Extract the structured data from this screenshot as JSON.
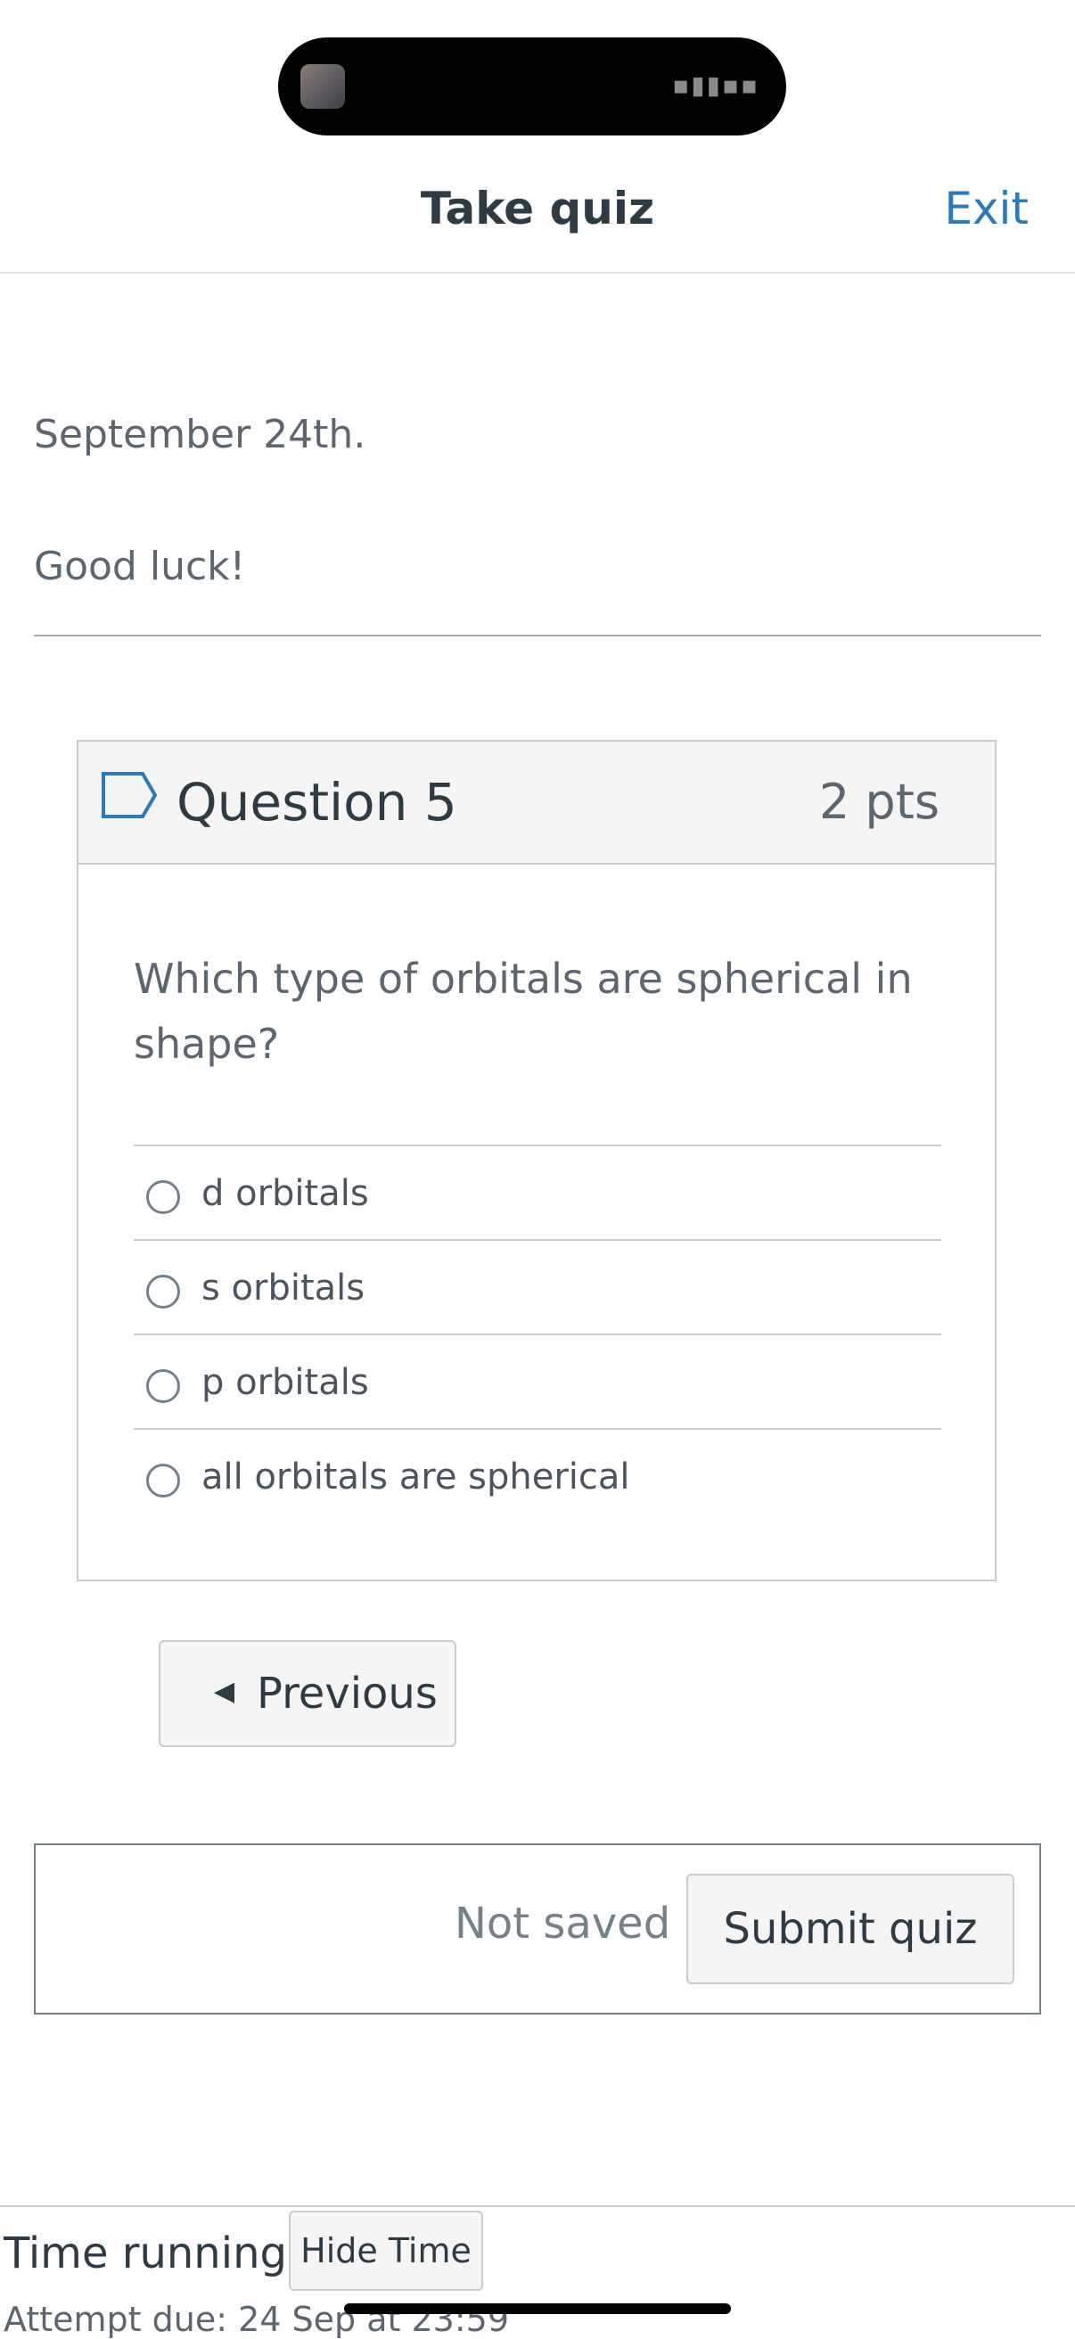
{
  "header": {
    "title": "Take quiz",
    "exit_label": "Exit"
  },
  "intro": {
    "line1": "September 24th.",
    "line2": "Good luck!"
  },
  "question": {
    "title": "Question 5",
    "points": "2 pts",
    "text": "Which type of orbitals are spherical in shape?",
    "answers": [
      {
        "label": "d orbitals",
        "selected": false
      },
      {
        "label": "s orbitals",
        "selected": false
      },
      {
        "label": "p orbitals",
        "selected": false
      },
      {
        "label": "all orbitals are spherical",
        "selected": false
      }
    ]
  },
  "nav": {
    "previous_label": "Previous"
  },
  "submit": {
    "status": "Not saved",
    "button_label": "Submit quiz"
  },
  "timer": {
    "label": "Time running:",
    "hide_button": "Hide Time",
    "attempt_due": "Attempt due: 24 Sep at 23:59"
  },
  "colors": {
    "accent_link": "#2b7abc",
    "text_primary": "#2d3b45",
    "text_secondary": "#5b6670",
    "border": "#c7cdd1"
  }
}
